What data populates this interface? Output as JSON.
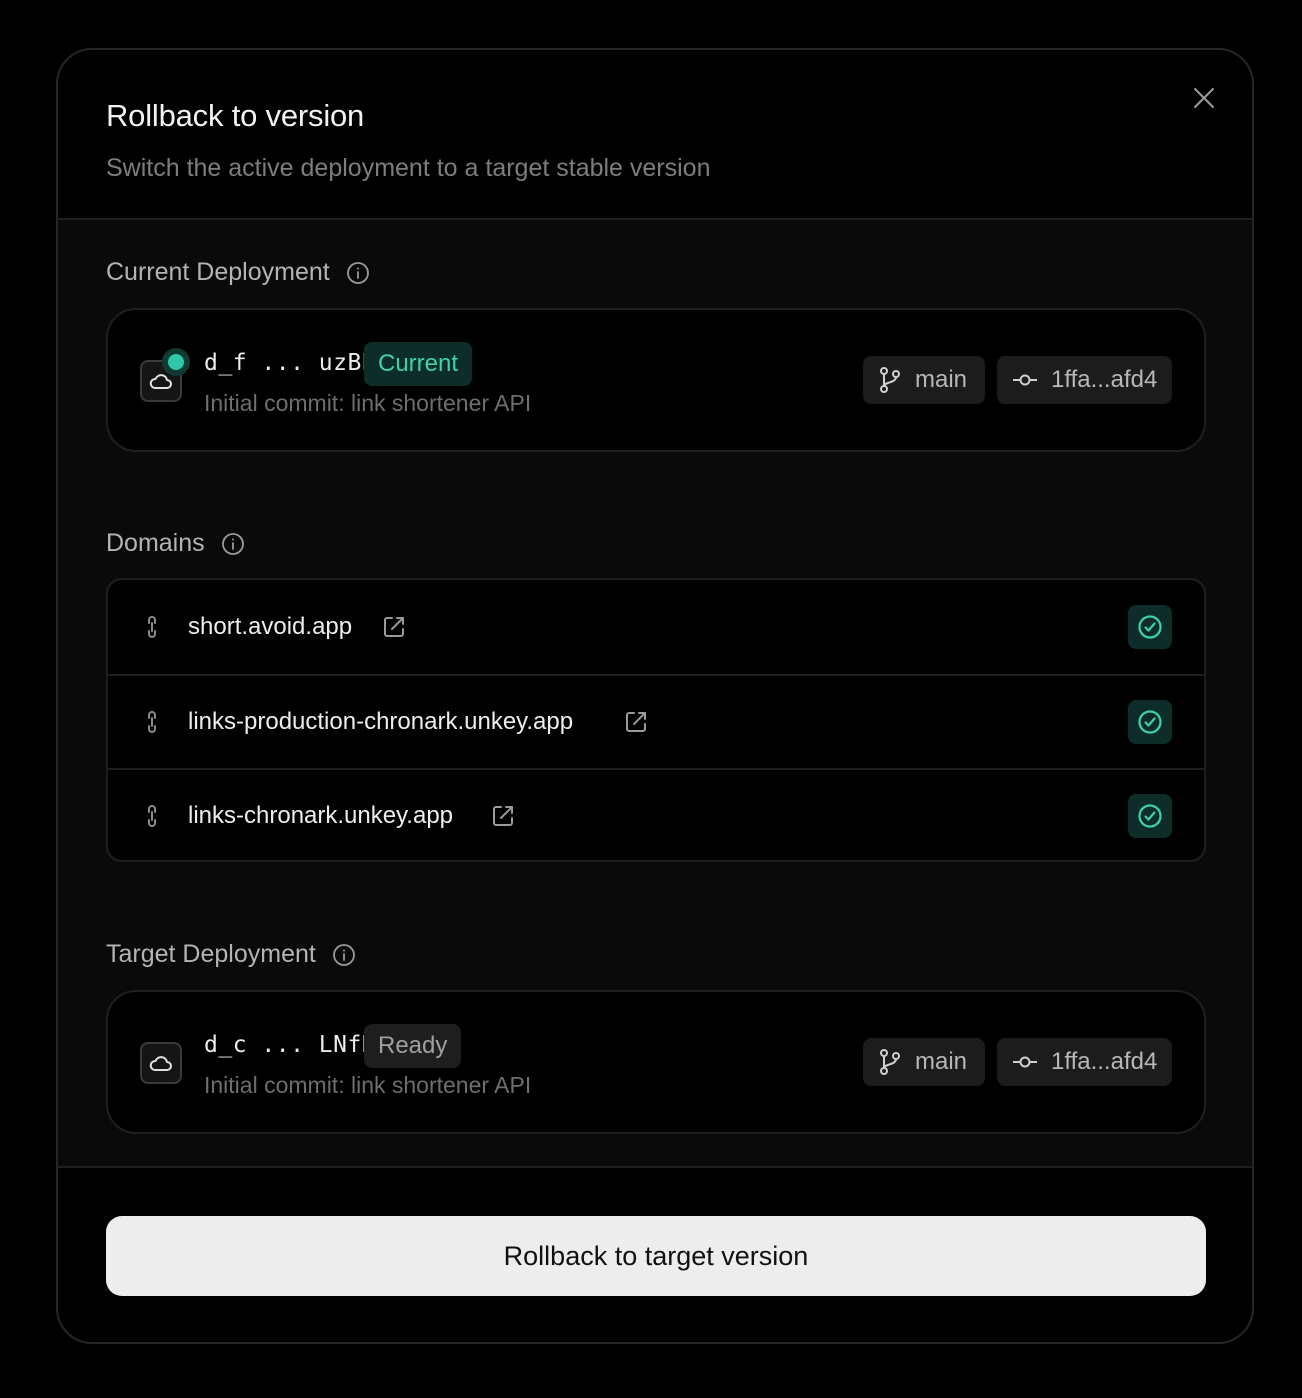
{
  "modal": {
    "title": "Rollback to version",
    "subtitle": "Switch the active deployment to a target stable version"
  },
  "current_section": {
    "label": "Current Deployment",
    "deployment": {
      "id": "d_f ... uzBB",
      "status": "Current",
      "commit_message": "Initial commit: link shortener API",
      "branch": "main",
      "commit": "1ffa...afd4"
    }
  },
  "domains_section": {
    "label": "Domains",
    "items": [
      {
        "name": "short.avoid.app"
      },
      {
        "name": "links-production-chronark.unkey.app"
      },
      {
        "name": "links-chronark.unkey.app"
      }
    ]
  },
  "target_section": {
    "label": "Target Deployment",
    "deployment": {
      "id": "d_c ... LNfH",
      "status": "Ready",
      "commit_message": "Initial commit: link shortener API",
      "branch": "main",
      "commit": "1ffa...afd4"
    }
  },
  "footer": {
    "primary_label": "Rollback to target version"
  },
  "colors": {
    "accent_green": "#2ec8a6",
    "badge_green_bg": "#0d2e28",
    "button_bg": "#ededed"
  },
  "icons": {
    "close": "close-icon",
    "info": "info-icon",
    "cloud": "cloud-icon",
    "branch": "git-branch-icon",
    "commit": "git-commit-icon",
    "link": "link-icon",
    "external": "external-link-icon",
    "verified": "check-circle-icon"
  }
}
